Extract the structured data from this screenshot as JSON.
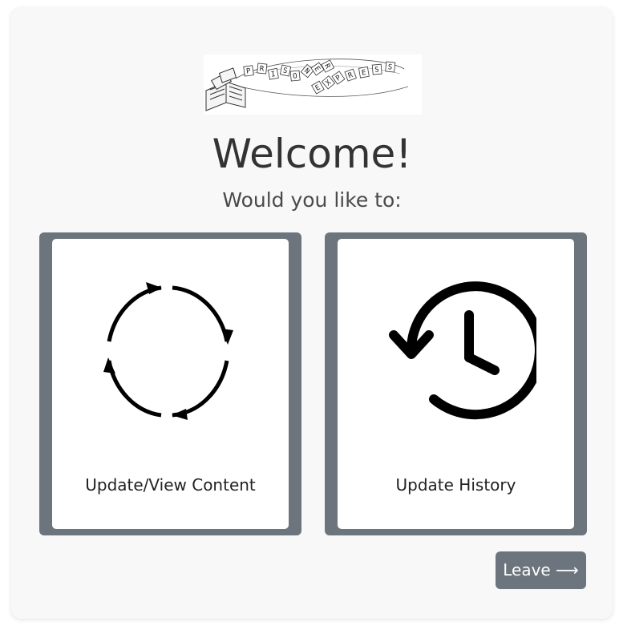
{
  "logo": {
    "lettering": "PRISONER EXPRESS",
    "icon": "open-book-logo"
  },
  "header": {
    "title": "Welcome!",
    "subtitle": "Would you like to:"
  },
  "options": [
    {
      "label": "Update/View Content",
      "icon": "refresh-cycle-icon"
    },
    {
      "label": "Update History",
      "icon": "history-clock-icon"
    }
  ],
  "leave_button": {
    "label": "Leave ⟶"
  },
  "colors": {
    "panel_background": "#f8f8f8",
    "card_border": "#6c757d",
    "button_background": "#6c757d",
    "text": "#333333"
  }
}
